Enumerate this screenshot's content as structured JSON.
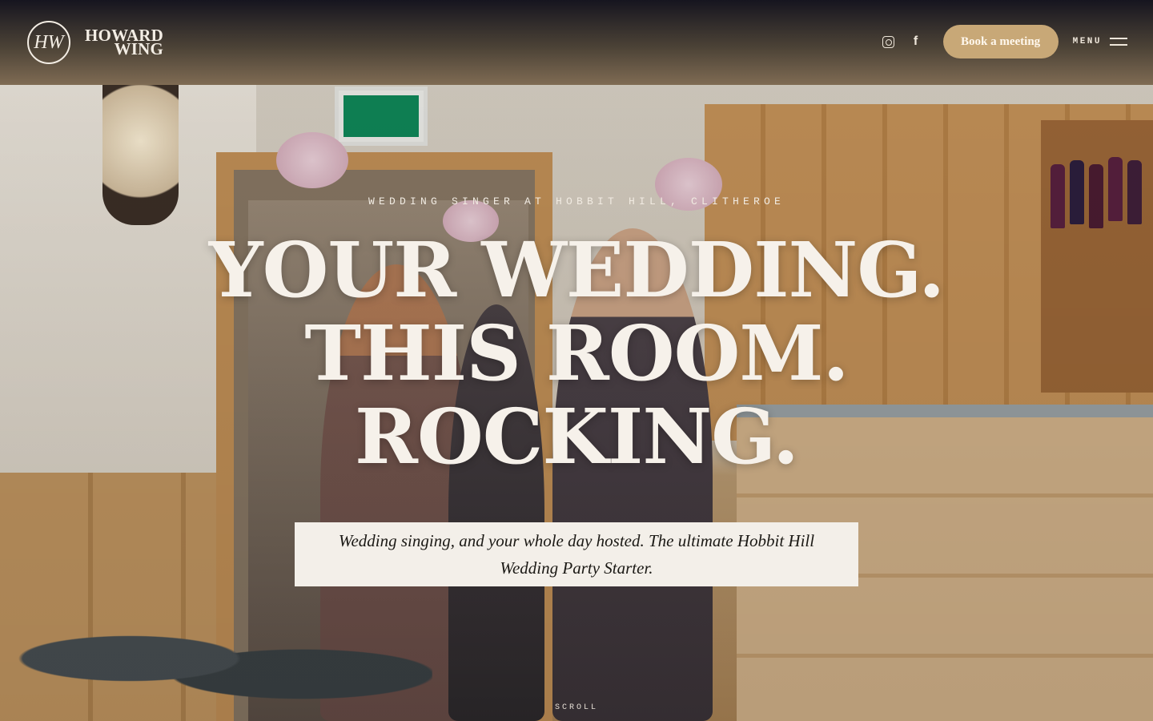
{
  "header": {
    "logo_monogram": "HW",
    "logo_line1": "HOWARD",
    "logo_line2": "WING",
    "social": [
      {
        "name": "instagram-icon"
      },
      {
        "name": "facebook-icon",
        "glyph": "f"
      }
    ],
    "book_button": "Book a meeting",
    "menu_label": "MENU"
  },
  "hero": {
    "eyebrow": "WEDDING SINGER AT HOBBIT HILL, CLITHEROE",
    "headline": [
      "YOUR WEDDING.",
      "THIS ROOM.",
      "ROCKING."
    ],
    "subtitle": "Wedding singing, and your whole day hosted. The ultimate Hobbit Hill Wedding Party Starter.",
    "scroll_label": "SCROLL"
  },
  "colors": {
    "accent": "#c8a877",
    "text_light": "#f6f1ea",
    "subbox_bg": "#f3efe9"
  }
}
